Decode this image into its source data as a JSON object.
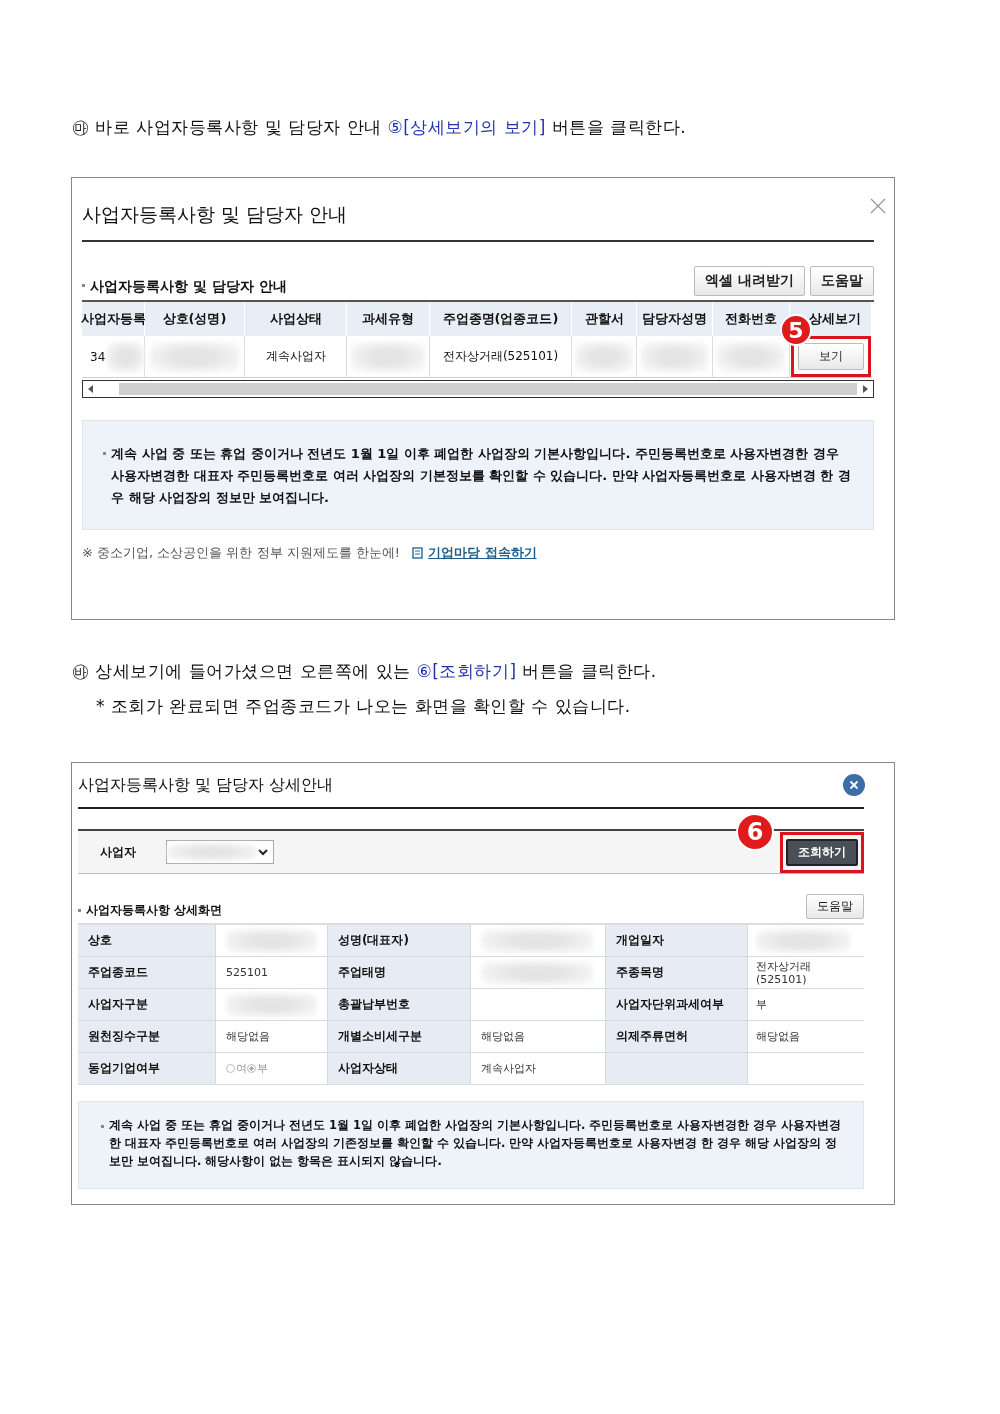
{
  "step_1": {
    "marker": "㉲",
    "text": "바로 사업자등록사항 및 담당자 안내",
    "ref_number": "⑤",
    "ref_label": "[상세보기의 보기]",
    "text_end": "버튼을 클릭한다."
  },
  "dialog_1": {
    "title": "사업자등록사항 및 담당자 안내",
    "section_title": "사업자등록사항 및 담당자 안내",
    "buttons": [
      "엑셀 내려받기",
      "도움말"
    ],
    "table": {
      "columns": [
        "사업자등록",
        "상호(성명)",
        "사업상태",
        "과세유형",
        "주업종명(업종코드)",
        "관할서",
        "담당자성명",
        "전화번호",
        "상세보기"
      ],
      "row": [
        {
          "text": "34",
          "redacted": true
        },
        {
          "redacted": true
        },
        {
          "text": "계속사업자",
          "redacted": false
        },
        {
          "redacted": true
        },
        {
          "text": "전자상거래(525101)",
          "redacted": false
        },
        {
          "redacted": true
        },
        {
          "redacted": true
        },
        {
          "redacted": true
        }
      ],
      "view_button": "보기",
      "callout": "5"
    },
    "notice": "계속 사업 중 또는 휴업 중이거나 전년도 1월 1일 이후 폐업한 사업장의 기본사항입니다. 주민등록번호로 사용자변경한 경우 사용자변경한 대표자 주민등록번호로 여러 사업장의 기본정보를 확인할 수 있습니다. 만약 사업자등록번호로 사용자변경 한 경우 해당 사업장의 정보만 보여집니다.",
    "footer_note": "※ 중소기업, 소상공인을 위한 정부 지원제도를 한눈에!",
    "link": "기업마당 접속하기"
  },
  "step_2": {
    "marker": "㉳",
    "text": "상세보기에 들어가셨으면 오른쪽에 있는",
    "ref_number": "⑥",
    "ref_label": "[조회하기]",
    "text_end": "버튼을 클릭한다.",
    "note": "* 조회가 완료되면 주업종코드가 나오는 화면을 확인할 수 있습니다."
  },
  "dialog_2": {
    "title": "사업자등록사항 및 담당자 상세안내",
    "filter_label": "사업자",
    "search_button": "조회하기",
    "callout": "6",
    "section_title": "사업자등록사항 상세화면",
    "help_button": "도움말",
    "rows": [
      [
        {
          "label": "상호",
          "value": {
            "redacted": true
          }
        },
        {
          "label": "성명(대표자)",
          "value": {
            "redacted": true
          }
        },
        {
          "label": "개업일자",
          "value": {
            "redacted": true
          }
        }
      ],
      [
        {
          "label": "주업종코드",
          "value": {
            "text": "525101",
            "redacted": false
          }
        },
        {
          "label": "주업태명",
          "value": {
            "redacted": true
          }
        },
        {
          "label": "주종목명",
          "value": {
            "text": "전자상거래(525101)",
            "redacted": false
          }
        }
      ],
      [
        {
          "label": "사업자구분",
          "value": {
            "redacted": true
          }
        },
        {
          "label": "총괄납부번호"
        },
        {
          "label": "사업자단위과세여부",
          "value": {
            "text": "부",
            "redacted": false
          }
        }
      ],
      [
        {
          "label": "원천징수구분",
          "value": {
            "text": "해당없음",
            "redacted": false
          }
        },
        {
          "label": "개별소비세구분",
          "value": {
            "text": "해당없음",
            "redacted": false
          }
        },
        {
          "label": "의제주류면허",
          "value": {
            "text": "해당없음",
            "redacted": false
          }
        }
      ],
      [
        {
          "label": "동업기업여부",
          "value": {
            "kind": "radio",
            "options": [
              {
                "label": "여",
                "selected": false
              },
              {
                "label": "부",
                "selected": true
              }
            ]
          }
        },
        {
          "label": "사업자상태",
          "value": {
            "text": "계속사업자",
            "redacted": false
          }
        }
      ]
    ],
    "notice": "계속 사업 중 또는 휴업 중이거나 전년도 1월 1일 이후 폐업한 사업장의 기본사항입니다. 주민등록번호로 사용자변경한 경우 사용자변경한 대표자 주민등록번호로 여러 사업장의 기존정보를 확인할 수 있습니다. 만약 사업자등록번호로 사용자변경 한 경우 해당 사업장의 정보만 보여집니다. 해당사항이 없는 항목은 표시되지 않습니다."
  }
}
